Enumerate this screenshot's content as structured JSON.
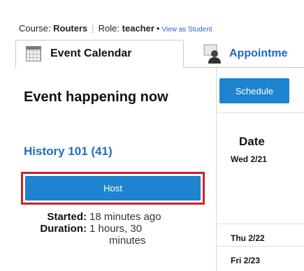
{
  "header": {
    "course_label": "Course:",
    "course_value": "Routers",
    "role_label": "Role:",
    "role_value": "teacher",
    "view_as_link": "View as Student"
  },
  "tabs": [
    {
      "label": "Event Calendar",
      "icon": "calendar-icon",
      "active": true
    },
    {
      "label": "Appointme",
      "icon": "person-icon",
      "active": false
    }
  ],
  "event_panel": {
    "title": "Event happening now",
    "course_link": "History 101 (41)",
    "host_button": "Host",
    "started_label": "Started:",
    "started_value": "18 minutes ago",
    "duration_label": "Duration:",
    "duration_value_line1": "1 hours, 30",
    "duration_value_line2": "minutes"
  },
  "schedule": {
    "button_label": "Schedule",
    "date_header": "Date",
    "dates": [
      "Wed 2/21",
      "Thu 2/22",
      "Fri 2/23"
    ]
  },
  "colors": {
    "button_blue": "#1f84cf",
    "link_blue": "#1f6fbf",
    "highlight_red": "#d0202a"
  }
}
